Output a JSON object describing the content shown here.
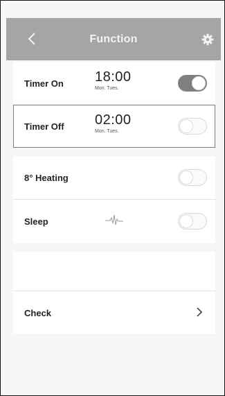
{
  "header": {
    "title": "Function",
    "back_icon": "chevron-left-icon",
    "settings_icon": "gear-icon"
  },
  "timer_on": {
    "label": "Timer On",
    "time": "18:00",
    "days": "Mon. Tues.",
    "enabled": true
  },
  "timer_off": {
    "label": "Timer Off",
    "time": "02:00",
    "days": "Mon. Tues.",
    "enabled": false
  },
  "heating": {
    "label": "8° Heating",
    "enabled": false
  },
  "sleep": {
    "label": "Sleep",
    "icon": "sleep-wave-icon",
    "enabled": false
  },
  "check": {
    "label": "Check",
    "icon": "chevron-right-icon"
  },
  "colors": {
    "header": "#a5a5a5",
    "toggle_on": "#7f7f7f",
    "background": "#f6f6f6"
  }
}
